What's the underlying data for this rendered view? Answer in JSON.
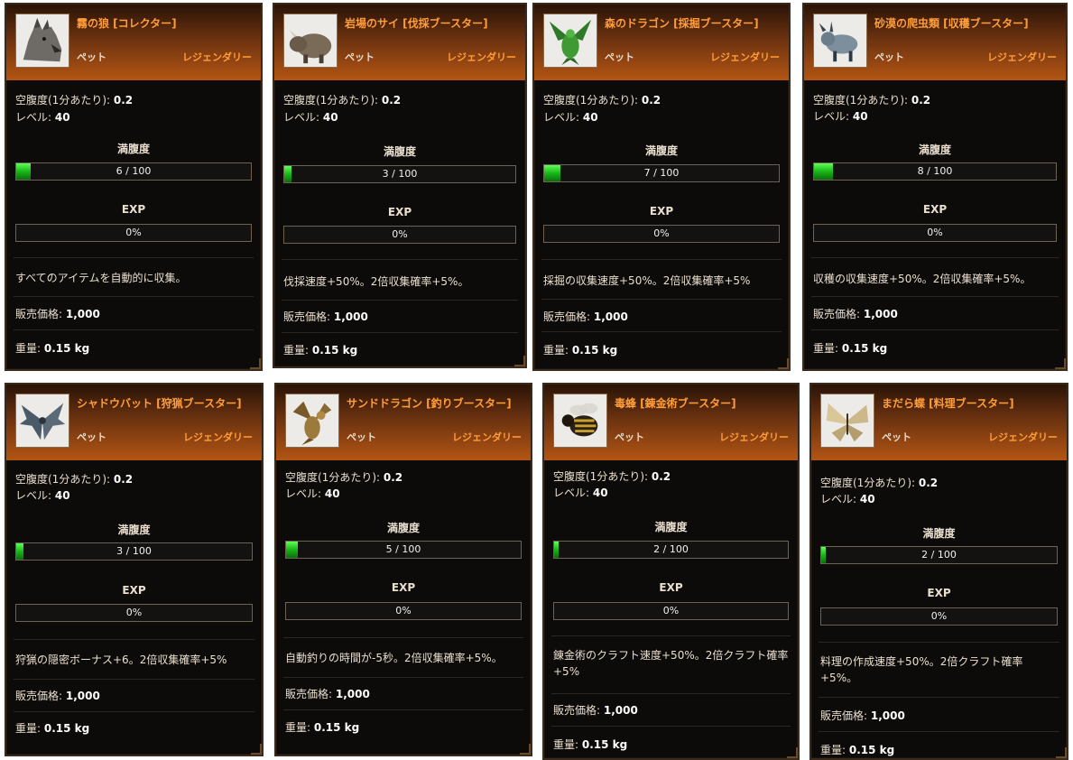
{
  "labels": {
    "hunger_rate": "空腹度(1分あたり):",
    "level": "レベル:",
    "satiety": "満腹度",
    "exp": "EXP",
    "price": "販売価格:",
    "weight": "重量:",
    "type": "ペット",
    "rarity": "レジェンダリー"
  },
  "colors": {
    "title": "#ff9d3a",
    "bar_fill": "#19b619",
    "header": "#b35513"
  },
  "pets": [
    {
      "name": "霧の狼 [コレクター]",
      "icon": "wolf-icon",
      "hunger_rate": "0.2",
      "level": "40",
      "satiety": "6 / 100",
      "satiety_fraction": 0.06,
      "exp": "0%",
      "exp_fraction": 0,
      "description": "すべてのアイテムを自動的に収集。",
      "price": "1,000",
      "weight": "0.15 kg"
    },
    {
      "name": "岩場のサイ [伐採ブースター]",
      "icon": "rhino-icon",
      "hunger_rate": "0.2",
      "level": "40",
      "satiety": "3 / 100",
      "satiety_fraction": 0.03,
      "exp": "0%",
      "exp_fraction": 0,
      "description": "伐採速度+50%。2倍収集確率+5%。",
      "price": "1,000",
      "weight": "0.15 kg"
    },
    {
      "name": "森のドラゴン [採掘ブースター]",
      "icon": "dragon-icon",
      "hunger_rate": "0.2",
      "level": "40",
      "satiety": "7 / 100",
      "satiety_fraction": 0.07,
      "exp": "0%",
      "exp_fraction": 0,
      "description": "採掘の収集速度+50%。2倍収集確率+5%",
      "price": "1,000",
      "weight": "0.15 kg"
    },
    {
      "name": "砂漠の爬虫類 [収穫ブースター]",
      "icon": "reptile-icon",
      "hunger_rate": "0.2",
      "level": "40",
      "satiety": "8 / 100",
      "satiety_fraction": 0.08,
      "exp": "0%",
      "exp_fraction": 0,
      "description": "収穫の収集速度+50%。2倍収集確率+5%。",
      "price": "1,000",
      "weight": "0.15 kg"
    },
    {
      "name": "シャドウバット [狩猟ブースター]",
      "icon": "bat-icon",
      "hunger_rate": "0.2",
      "level": "40",
      "satiety": "3 / 100",
      "satiety_fraction": 0.03,
      "exp": "0%",
      "exp_fraction": 0,
      "description": "狩猟の隠密ボーナス+6。2倍収集確率+5%",
      "price": "1,000",
      "weight": "0.15 kg"
    },
    {
      "name": "サンドドラゴン [釣りブースター]",
      "icon": "sand-dragon-icon",
      "hunger_rate": "0.2",
      "level": "40",
      "satiety": "5 / 100",
      "satiety_fraction": 0.05,
      "exp": "0%",
      "exp_fraction": 0,
      "description": "自動釣りの時間が-5秒。2倍収集確率+5%。",
      "price": "1,000",
      "weight": "0.15 kg"
    },
    {
      "name": "毒蜂 [錬金術ブースター]",
      "icon": "bee-icon",
      "hunger_rate": "0.2",
      "level": "40",
      "satiety": "2 / 100",
      "satiety_fraction": 0.02,
      "exp": "0%",
      "exp_fraction": 0,
      "description": "錬金術のクラフト速度+50%。2倍クラフト確率+5%",
      "price": "1,000",
      "weight": "0.15 kg"
    },
    {
      "name": "まだら蝶 [料理ブースター]",
      "icon": "butterfly-icon",
      "hunger_rate": "0.2",
      "level": "40",
      "satiety": "2 / 100",
      "satiety_fraction": 0.02,
      "exp": "0%",
      "exp_fraction": 0,
      "description": "料理の作成速度+50%。2倍クラフト確率+5%。",
      "price": "1,000",
      "weight": "0.15 kg"
    }
  ]
}
